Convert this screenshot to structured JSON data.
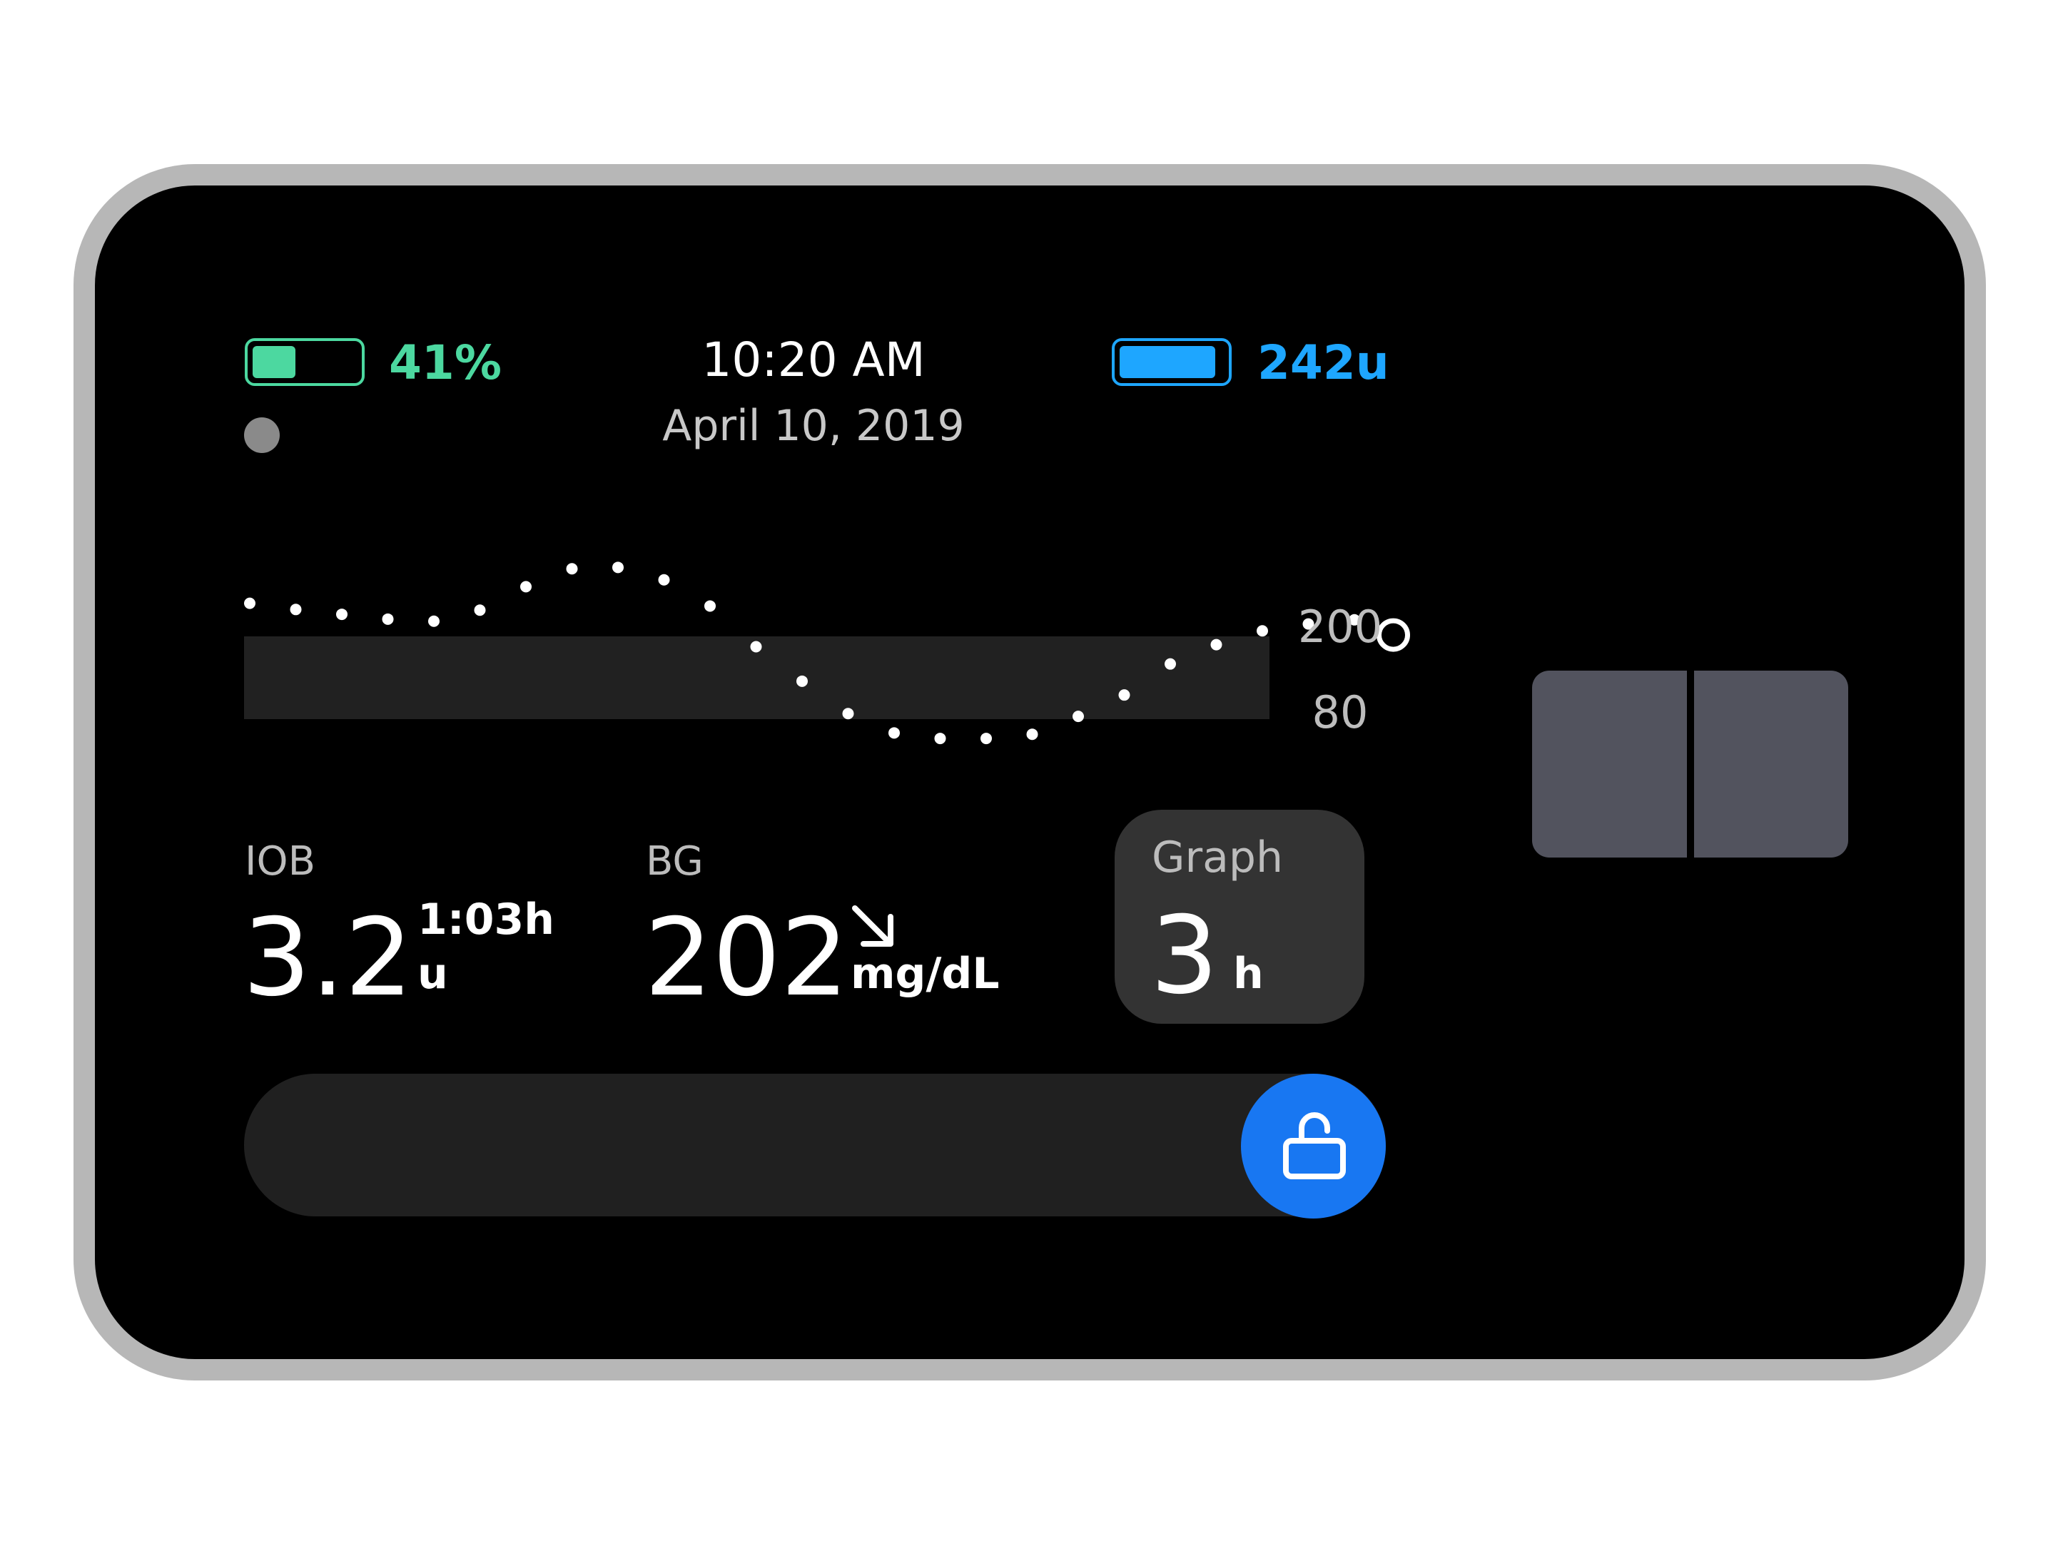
{
  "status_bar": {
    "battery_percent_text": "41%",
    "battery_level": 0.41,
    "time": "10:20 AM",
    "date": "April 10, 2019",
    "insulin_text": "242u",
    "insulin_level": 0.92,
    "colors": {
      "battery": "#4cd8a0",
      "insulin": "#1ea6ff"
    }
  },
  "cgm_graph": {
    "upper_label": "200",
    "lower_label": "80",
    "target_band": [
      80,
      200
    ],
    "readings": [
      248,
      239,
      232,
      225,
      222,
      238,
      272,
      298,
      300,
      282,
      244,
      185,
      135,
      88,
      60,
      52,
      52,
      58,
      84,
      115,
      160,
      188,
      208,
      218,
      224
    ],
    "current_reading": 202
  },
  "iob": {
    "label": "IOB",
    "value": "3.2",
    "unit": "u",
    "duration": "1:03h"
  },
  "bg": {
    "label": "BG",
    "value": "202",
    "unit": "mg/dL",
    "trend_icon": "arrow-down-right"
  },
  "graph_button": {
    "label": "Graph",
    "value": "3",
    "unit": "h"
  },
  "unlock": {
    "icon": "unlock-icon",
    "color": "#1877f2"
  }
}
